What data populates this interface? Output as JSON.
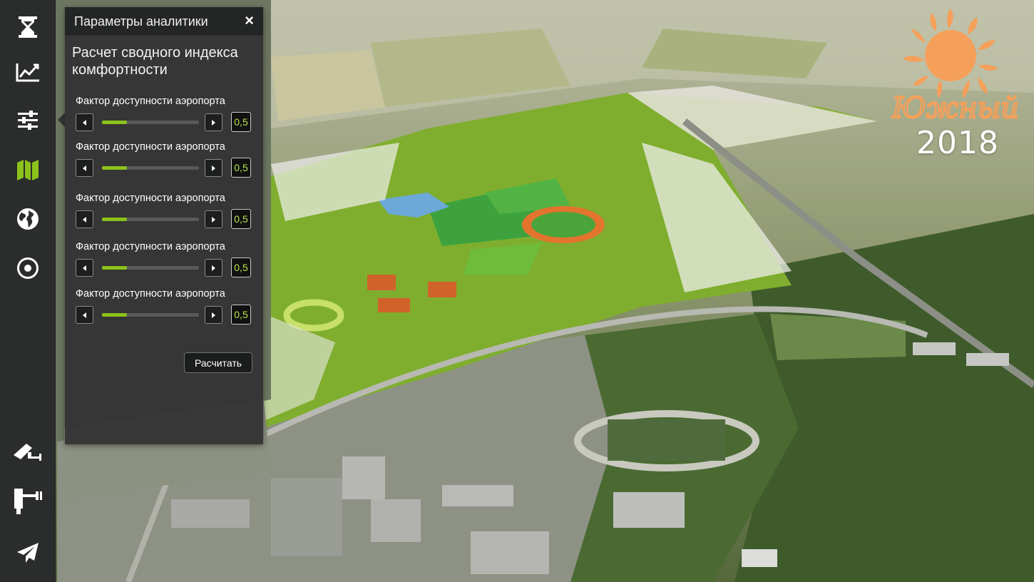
{
  "panel": {
    "title": "Параметры аналитики",
    "close_label": "×",
    "heading": "Расчет сводного индекса комфортности",
    "factors": [
      {
        "label": "Фактор доступности аэропорта",
        "value": "0,5",
        "fill_fraction": 0.26
      },
      {
        "label": "Фактор доступности аэропорта",
        "value": "0,5",
        "fill_fraction": 0.26
      },
      {
        "label": "Фактор доступности аэропорта",
        "value": "0,5",
        "fill_fraction": 0.26
      },
      {
        "label": "Фактор доступности аэропорта",
        "value": "0,5",
        "fill_fraction": 0.26
      },
      {
        "label": "Фактор доступности аэропорта",
        "value": "0,5",
        "fill_fraction": 0.26
      }
    ],
    "calculate_label": "Расчитать"
  },
  "toolbar": {
    "items": [
      "hourglass-icon",
      "line-chart-icon",
      "sliders-icon",
      "map-icon",
      "globe-icon",
      "target-icon",
      "camera-icon",
      "tripod-icon",
      "paper-plane-icon"
    ],
    "active_item": "map-icon"
  },
  "logo": {
    "name": "Южный",
    "year": "2018"
  },
  "colors": {
    "accent": "#8cc21c",
    "value_text": "#b4e34a",
    "logo_orange": "#f5a05a"
  }
}
